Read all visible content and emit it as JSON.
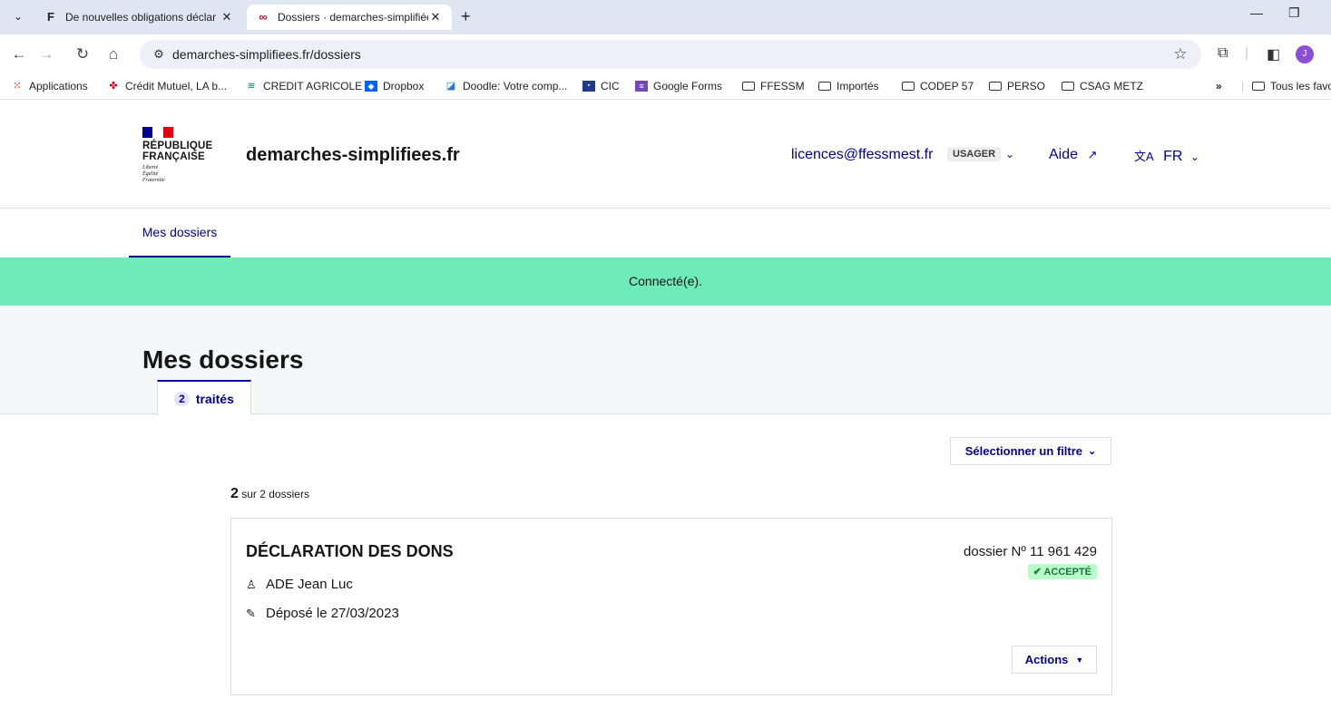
{
  "browser": {
    "tabs": [
      {
        "title": "De nouvelles obligations déclar",
        "favicon": "F"
      },
      {
        "title": "Dossiers · demarches-simplifiée",
        "favicon": "∞"
      }
    ],
    "url": "demarches-simplifiees.fr/dossiers",
    "profile_initial": "J",
    "bookmarks": [
      {
        "label": "Applications",
        "icon": "apps-grid-icon"
      },
      {
        "label": "Crédit Mutuel, LA b...",
        "icon": "credit-mutuel-icon"
      },
      {
        "label": "CREDIT AGRICOLE",
        "icon": "credit-agricole-icon"
      },
      {
        "label": "Dropbox",
        "icon": "dropbox-icon"
      },
      {
        "label": "Doodle: Votre comp...",
        "icon": "doodle-icon"
      },
      {
        "label": "CIC",
        "icon": "cic-icon"
      },
      {
        "label": "Google Forms",
        "icon": "google-forms-icon"
      },
      {
        "label": "FFESSM",
        "icon": "folder-icon"
      },
      {
        "label": "Importés",
        "icon": "folder-icon"
      },
      {
        "label": "CODEP 57",
        "icon": "folder-icon"
      },
      {
        "label": "PERSO",
        "icon": "folder-icon"
      },
      {
        "label": "CSAG METZ",
        "icon": "folder-icon"
      }
    ],
    "bookmarks_overflow": "»",
    "all_bookmarks": "Tous les favo"
  },
  "header": {
    "rf_line1": "RÉPUBLIQUE",
    "rf_line2": "FRANÇAISE",
    "devise": [
      "Liberté",
      "Égalité",
      "Fraternité"
    ],
    "site_name": "demarches-simplifiees.fr",
    "user_email": "licences@ffessmest.fr",
    "user_role": "USAGER",
    "help": "Aide",
    "lang": "FR"
  },
  "subnav": {
    "item": "Mes dossiers"
  },
  "flash": "Connecté(e).",
  "page": {
    "title": "Mes dossiers",
    "tab_count": "2",
    "tab_label": "traités",
    "filter": "Sélectionner un filtre",
    "result_count": "2",
    "result_label": "sur 2 dossiers"
  },
  "dossier": {
    "title": "DÉCLARATION DES DONS",
    "number": "dossier Nº  11 961 429",
    "status": "ACCEPTÉ",
    "person": "ADE Jean Luc",
    "deposited": "Déposé le 27/03/2023",
    "actions": "Actions"
  },
  "colors": {
    "accent": "#000091",
    "flash": "#6eeabb",
    "status_bg": "#b8fec9",
    "status_fg": "#18753c"
  }
}
